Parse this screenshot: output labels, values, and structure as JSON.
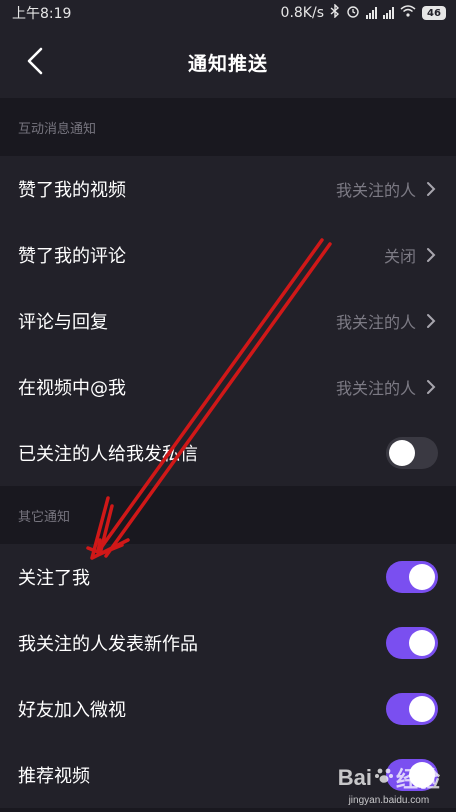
{
  "status_bar": {
    "time": "上午8:19",
    "net_speed": "0.8K/s",
    "battery": "46"
  },
  "nav": {
    "title": "通知推送",
    "back_icon": "chevron-left-icon"
  },
  "sections": [
    {
      "header": "互动消息通知",
      "items": [
        {
          "label": "赞了我的视频",
          "value": "我关注的人"
        },
        {
          "label": "赞了我的评论",
          "value": "关闭"
        },
        {
          "label": "评论与回复",
          "value": "我关注的人"
        },
        {
          "label": "在视频中@我",
          "value": "我关注的人"
        },
        {
          "label": "已关注的人给我发私信",
          "toggle": false
        }
      ]
    },
    {
      "header": "其它通知",
      "items": [
        {
          "label": "关注了我",
          "toggle": true
        },
        {
          "label": "我关注的人发表新作品",
          "toggle": true
        },
        {
          "label": "好友加入微视",
          "toggle": true
        },
        {
          "label": "推荐视频",
          "toggle": true
        }
      ]
    }
  ],
  "annotation": {
    "color": "#d01818"
  },
  "watermark": {
    "brand": "Bai",
    "brand2": "经验",
    "url": "jingyan.baidu.com"
  },
  "colors": {
    "accent": "#7a4ff0",
    "background": "#19181f",
    "row": "#222129"
  }
}
